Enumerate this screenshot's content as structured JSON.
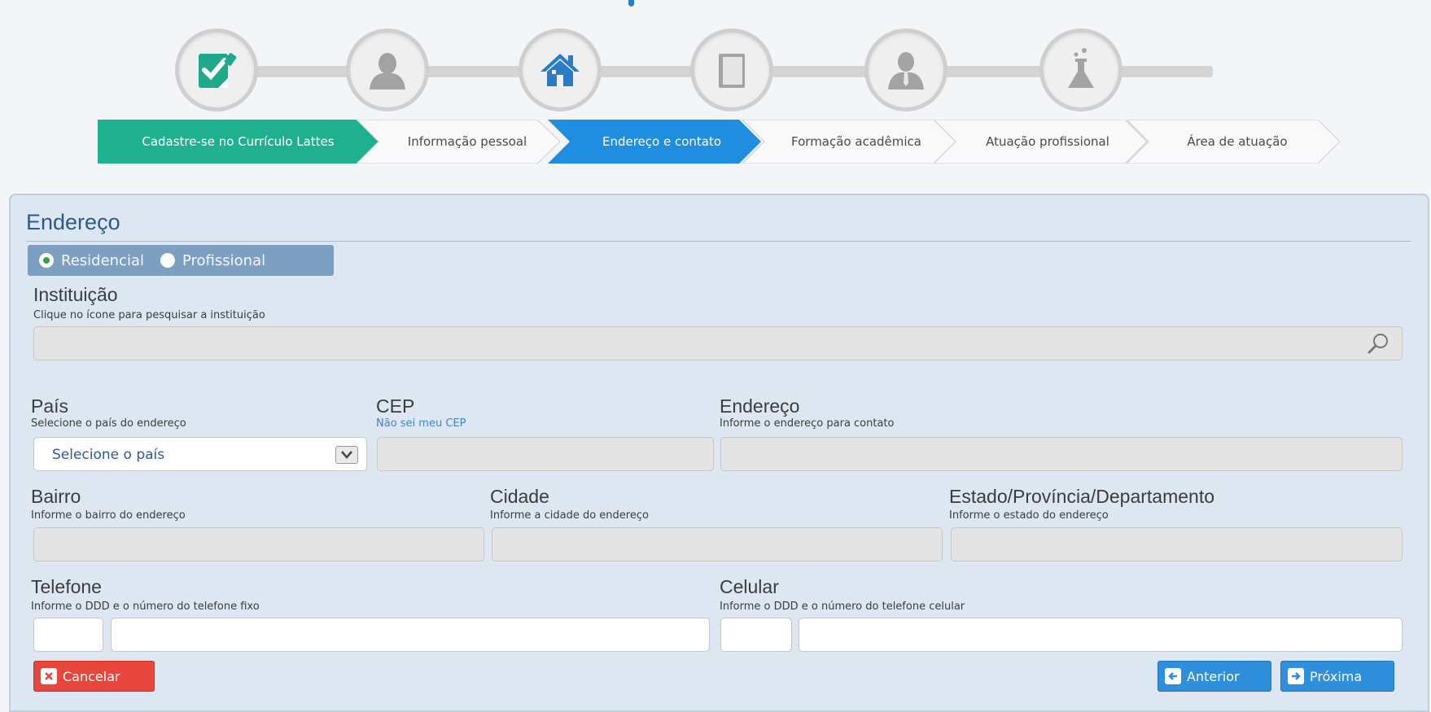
{
  "steps": [
    {
      "id": "cadastro",
      "icon": "edit-check-icon",
      "color": "#1fa98b"
    },
    {
      "id": "pessoal",
      "icon": "person-icon",
      "color": "#9a9a9a"
    },
    {
      "id": "endereco",
      "icon": "house-icon",
      "color": "#2a7cc7"
    },
    {
      "id": "formacao",
      "icon": "book-icon",
      "color": "#9a9a9a"
    },
    {
      "id": "atuacao",
      "icon": "professional-icon",
      "color": "#9a9a9a"
    },
    {
      "id": "area",
      "icon": "flask-icon",
      "color": "#9a9a9a"
    }
  ],
  "breadcrumb": [
    {
      "label": "Cadastre-se no Currículo Lattes",
      "state": "done",
      "color": "#1fb08f"
    },
    {
      "label": "Informação pessoal",
      "state": "pending"
    },
    {
      "label": "Endereço e contato",
      "state": "active",
      "color": "#1f8ee0"
    },
    {
      "label": "Formação acadêmica",
      "state": "pending"
    },
    {
      "label": "Atuação profissional",
      "state": "pending"
    },
    {
      "label": "Área de atuação",
      "state": "pending"
    }
  ],
  "section": {
    "title": "Endereço"
  },
  "address_type": {
    "options": [
      "Residencial",
      "Profissional"
    ],
    "selected": "Residencial"
  },
  "instituicao": {
    "label": "Instituição",
    "hint": "Clique no ícone para pesquisar a instituição",
    "value": ""
  },
  "pais": {
    "label": "País",
    "hint": "Selecione o país do endereço",
    "selected": "Selecione o país"
  },
  "cep": {
    "label": "CEP",
    "link": "Não sei meu CEP",
    "value": ""
  },
  "endereco": {
    "label": "Endereço",
    "hint": "Informe o endereço para contato",
    "value": ""
  },
  "bairro": {
    "label": "Bairro",
    "hint": "Informe o bairro do endereço",
    "value": ""
  },
  "cidade": {
    "label": "Cidade",
    "hint": "Informe a cidade do endereço",
    "value": ""
  },
  "estado": {
    "label": "Estado/Província/Departamento",
    "hint": "Informe o estado do endereço",
    "value": ""
  },
  "telefone": {
    "label": "Telefone",
    "hint": "Informe o DDD e o número do telefone fixo",
    "ddd": "",
    "numero": ""
  },
  "celular": {
    "label": "Celular",
    "hint": "Informe o DDD e o número do telefone celular",
    "ddd": "",
    "numero": ""
  },
  "buttons": {
    "cancel": "Cancelar",
    "previous": "Anterior",
    "next": "Próxima"
  }
}
